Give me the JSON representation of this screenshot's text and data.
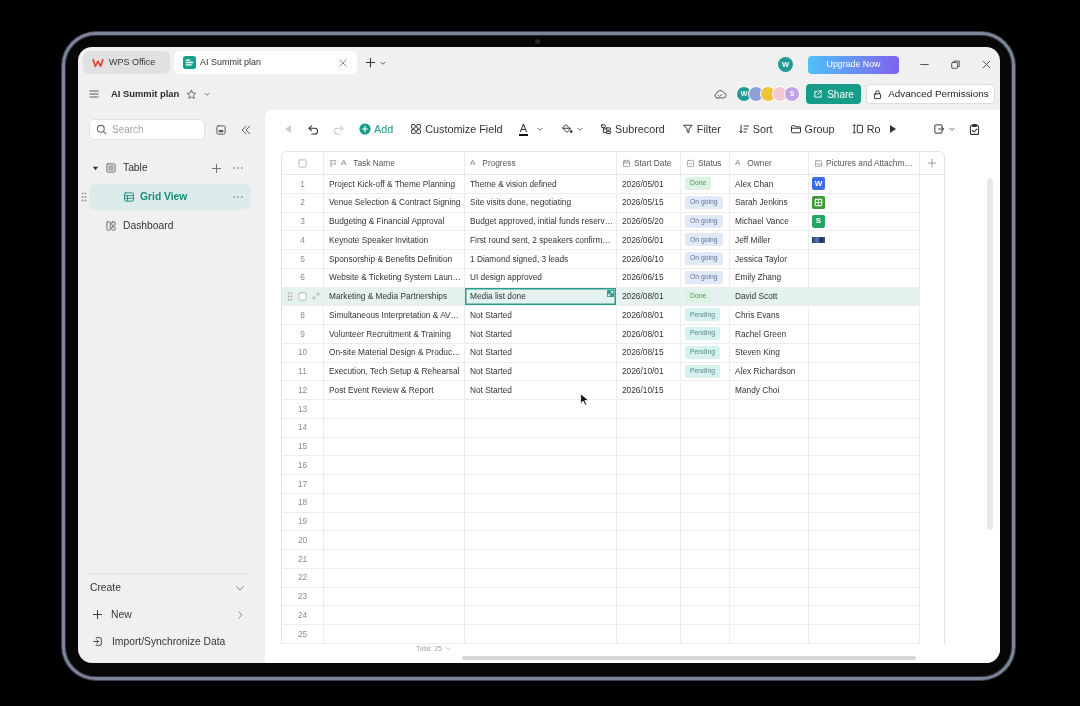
{
  "tabs": [
    {
      "label": "WPS Office",
      "kind": "home",
      "selected": false
    },
    {
      "label": "AI Summit plan",
      "kind": "document",
      "selected": true
    }
  ],
  "title_bar": {
    "account_initial": "W",
    "upgrade_button": "Upgrade Now"
  },
  "document_header": {
    "title": "AI Summit plan",
    "collaborators": [
      {
        "initial": "W",
        "color": "#1f9b93"
      },
      {
        "color": "#8ea2d8"
      },
      {
        "color": "#f0c23c"
      },
      {
        "color": "#f4c7d6"
      },
      {
        "initial": "S",
        "color": "#c0a3e4"
      }
    ],
    "share_button": "Share",
    "permissions_button": "Advanced Permissions"
  },
  "sidebar": {
    "search": {
      "placeholder": "Search"
    },
    "tree": [
      {
        "label": "Table",
        "kind": "table",
        "expanded": true,
        "selected": false,
        "children": [
          {
            "label": "Grid View",
            "kind": "grid",
            "selected": true
          }
        ]
      },
      {
        "label": "Dashboard",
        "kind": "dashboard",
        "selected": false
      }
    ],
    "create": {
      "label": "Create",
      "expanded": true,
      "items": [
        {
          "label": "New",
          "kind": "new"
        },
        {
          "label": "Import/Synchronize Data",
          "kind": "import"
        }
      ]
    }
  },
  "toolbar": {
    "items": [
      {
        "kind": "back",
        "disabled": true
      },
      {
        "kind": "undo",
        "disabled": false
      },
      {
        "kind": "redo",
        "disabled": true
      },
      {
        "kind": "add",
        "label": "Add",
        "disabled": false
      },
      {
        "kind": "customize",
        "label": "Customize Field",
        "disabled": false
      },
      {
        "kind": "text-color",
        "glyph": "A",
        "disabled": false
      },
      {
        "kind": "fill-color",
        "disabled": false
      },
      {
        "kind": "subrecord",
        "label": "Subrecord",
        "disabled": false
      },
      {
        "kind": "filter",
        "label": "Filter",
        "disabled": false
      },
      {
        "kind": "sort",
        "label": "Sort",
        "disabled": false
      },
      {
        "kind": "group",
        "label": "Group",
        "disabled": false
      },
      {
        "kind": "row-height",
        "label": "Ro",
        "disabled": false
      },
      {
        "kind": "scroll-right",
        "disabled": false
      },
      {
        "kind": "export",
        "disabled": false
      },
      {
        "kind": "checklist",
        "disabled": false
      }
    ]
  },
  "table": {
    "select_all_checked": false,
    "columns": [
      {
        "label": "Task Name",
        "kind": "primary",
        "glyph": "A"
      },
      {
        "label": "Progress",
        "kind": "text",
        "glyph": "A"
      },
      {
        "label": "Start Date",
        "kind": "date"
      },
      {
        "label": "Status",
        "kind": "select"
      },
      {
        "label": "Owner",
        "kind": "text",
        "glyph": "A"
      },
      {
        "label": "Pictures and Attachm…",
        "kind": "attachment"
      }
    ],
    "rows": [
      {
        "number": "1",
        "task": "Project Kick-off & Theme Planning",
        "progress": "Theme & vision defined",
        "start_date": "2026/05/01",
        "status": {
          "label": "Done",
          "kind": "done"
        },
        "owner": "Alex Chan",
        "attachments": [
          {
            "kind": "letter",
            "text": "W",
            "color": "#3b6fe6"
          }
        ],
        "selected": false,
        "checked": false,
        "progress_focused": false
      },
      {
        "number": "2",
        "task": "Venue Selection & Contract Signing",
        "progress": "Site visits done, negotiating",
        "start_date": "2026/05/15",
        "status": {
          "label": "On going",
          "kind": "ongoing"
        },
        "owner": "Sarah Jenkins",
        "attachments": [
          {
            "kind": "grid",
            "color": "#3f9a35"
          }
        ],
        "selected": false,
        "checked": false,
        "progress_focused": false
      },
      {
        "number": "3",
        "task": "Budgeting & Financial Approval",
        "progress": "Budget approved, initial funds reserv…",
        "start_date": "2026/05/20",
        "status": {
          "label": "On going",
          "kind": "ongoing"
        },
        "owner": "Michael Vance",
        "attachments": [
          {
            "kind": "letter",
            "text": "S",
            "color": "#22a560"
          }
        ],
        "selected": false,
        "checked": false,
        "progress_focused": false
      },
      {
        "number": "4",
        "task": "Keynote Speaker Invitation",
        "progress": "First round sent, 2 speakers confirm…",
        "start_date": "2026/06/01",
        "status": {
          "label": "On going",
          "kind": "ongoing"
        },
        "owner": "Jeff Miller",
        "attachments": [
          {
            "kind": "photo"
          }
        ],
        "selected": false,
        "checked": false,
        "progress_focused": false
      },
      {
        "number": "5",
        "task": "Sponsorship & Benefits Definition",
        "progress": "1 Diamond signed, 3 leads",
        "start_date": "2026/06/10",
        "status": {
          "label": "On going",
          "kind": "ongoing"
        },
        "owner": "Jessica Taylor",
        "selected": false,
        "checked": false,
        "progress_focused": false
      },
      {
        "number": "6",
        "task": "Website & Ticketing System Laun…",
        "progress": "UI design approved",
        "start_date": "2026/06/15",
        "status": {
          "label": "On going",
          "kind": "ongoing"
        },
        "owner": "Emily Zhang",
        "selected": false,
        "checked": false,
        "progress_focused": false
      },
      {
        "task": "Marketing & Media Partnerships",
        "progress": "Media list done",
        "start_date": "2026/08/01",
        "status": {
          "label": "Done",
          "kind": "done"
        },
        "owner": "David Scott",
        "selected": true,
        "checked": false,
        "progress_focused": true
      },
      {
        "number": "8",
        "task": "Simultaneous Interpretation & AV…",
        "progress": "Not Started",
        "start_date": "2026/08/01",
        "status": {
          "label": "Pending",
          "kind": "pending"
        },
        "owner": "Chris Evans",
        "selected": false,
        "checked": false,
        "progress_focused": false
      },
      {
        "number": "9",
        "task": "Volunteer Recruitment & Training",
        "progress": "Not Started",
        "start_date": "2026/08/01",
        "status": {
          "label": "Pending",
          "kind": "pending"
        },
        "owner": "Rachel Green",
        "selected": false,
        "checked": false,
        "progress_focused": false
      },
      {
        "number": "10",
        "task": "On-site Material Design & Produc…",
        "progress": "Not Started",
        "start_date": "2026/08/15",
        "status": {
          "label": "Pending",
          "kind": "pending"
        },
        "owner": "Steven King",
        "selected": false,
        "checked": false,
        "progress_focused": false
      },
      {
        "number": "11",
        "task": "Execution, Tech Setup & Rehearsal",
        "progress": "Not Started",
        "start_date": "2026/10/01",
        "status": {
          "label": "Pending",
          "kind": "pending"
        },
        "owner": "Alex Richardson",
        "selected": false,
        "checked": false,
        "progress_focused": false
      },
      {
        "number": "12",
        "task": "Post Event Review & Report",
        "progress": "Not Started",
        "start_date": "2026/10/15",
        "owner": "Mandy Choi",
        "selected": false,
        "checked": false,
        "progress_focused": false
      },
      {
        "number": "13",
        "selected": false,
        "checked": false,
        "progress_focused": false
      },
      {
        "number": "14",
        "selected": false,
        "checked": false,
        "progress_focused": false
      },
      {
        "number": "15",
        "selected": false,
        "checked": false,
        "progress_focused": false
      },
      {
        "number": "16",
        "selected": false,
        "checked": false,
        "progress_focused": false
      },
      {
        "number": "17",
        "selected": false,
        "checked": false,
        "progress_focused": false
      },
      {
        "number": "18",
        "selected": false,
        "checked": false,
        "progress_focused": false
      },
      {
        "number": "19",
        "selected": false,
        "checked": false,
        "progress_focused": false
      },
      {
        "number": "20",
        "selected": false,
        "checked": false,
        "progress_focused": false
      },
      {
        "number": "21",
        "selected": false,
        "checked": false,
        "progress_focused": false
      },
      {
        "number": "22",
        "selected": false,
        "checked": false,
        "progress_focused": false
      },
      {
        "number": "23",
        "selected": false,
        "checked": false,
        "progress_focused": false
      },
      {
        "number": "24",
        "selected": false,
        "checked": false,
        "progress_focused": false
      },
      {
        "number": "25",
        "selected": false,
        "checked": false,
        "progress_focused": false
      }
    ],
    "total": "Total: 25"
  }
}
